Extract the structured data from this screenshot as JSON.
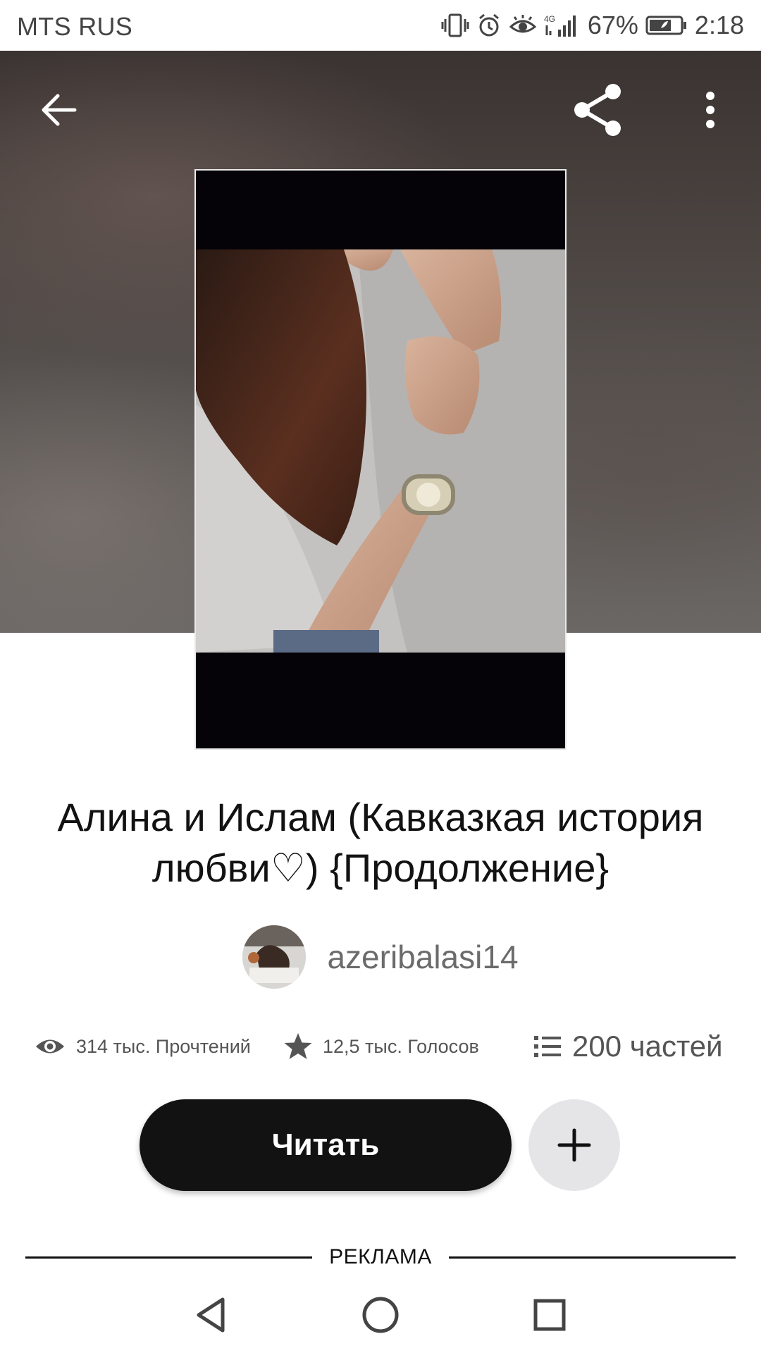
{
  "status_bar": {
    "carrier": "MTS RUS",
    "network": "4G",
    "battery_percent": "67%",
    "time": "2:18",
    "icons": [
      "vibrate-icon",
      "alarm-icon",
      "eye-comfort-icon",
      "signal-icon",
      "battery-icon"
    ]
  },
  "toolbar": {
    "back_icon": "arrow-left-icon",
    "share_icon": "share-icon",
    "more_icon": "more-vertical-icon"
  },
  "story": {
    "title": "Алина и Ислам (Кавказкая история любви♡) {Продолжение}",
    "author": "azeribalasi14"
  },
  "stats": {
    "reads": "314 тыс. Прочтений",
    "votes": "12,5 тыс. Голосов",
    "parts": "200 частей"
  },
  "actions": {
    "read_label": "Читать",
    "add_icon": "plus-icon"
  },
  "ad": {
    "label": "РЕКЛАМА"
  },
  "colors": {
    "primary_button": "#121212",
    "secondary_button": "#e5e4e6",
    "text_muted": "#555555"
  }
}
